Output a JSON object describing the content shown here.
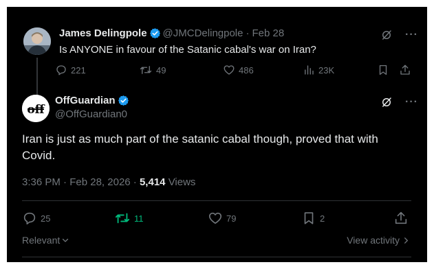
{
  "parent_tweet": {
    "display_name": "James Delingpole",
    "handle": "@JMCDelingpole",
    "separator": "·",
    "date": "Feb 28",
    "text": "Is ANYONE in favour of the Satanic cabal's war on Iran?",
    "replies": "221",
    "reposts": "49",
    "likes": "486",
    "views": "23K"
  },
  "main_tweet": {
    "display_name": "OffGuardian",
    "handle": "@OffGuardian0",
    "avatar_text": "off",
    "text": "Iran is just as much part of the satanic cabal though, proved that with Covid.",
    "time": "3:36 PM",
    "separator": "·",
    "date": "Feb 28, 2026",
    "meta_separator": "·",
    "views_count": "5,414",
    "views_label": "Views",
    "replies": "25",
    "reposts": "11",
    "likes": "79",
    "bookmarks": "2"
  },
  "footer": {
    "sort_label": "Relevant",
    "view_activity": "View activity"
  },
  "colors": {
    "background": "#000000",
    "text": "#e7e9ea",
    "muted": "#71767b",
    "verified": "#1d9bf0",
    "repost_active": "#00ba7c",
    "divider": "#2f3336"
  },
  "icons": [
    "verified-badge-icon",
    "grok-icon",
    "more-icon",
    "reply-icon",
    "repost-icon",
    "like-icon",
    "views-icon",
    "bookmark-icon",
    "share-icon",
    "chevron-down-icon",
    "chevron-right-icon"
  ]
}
